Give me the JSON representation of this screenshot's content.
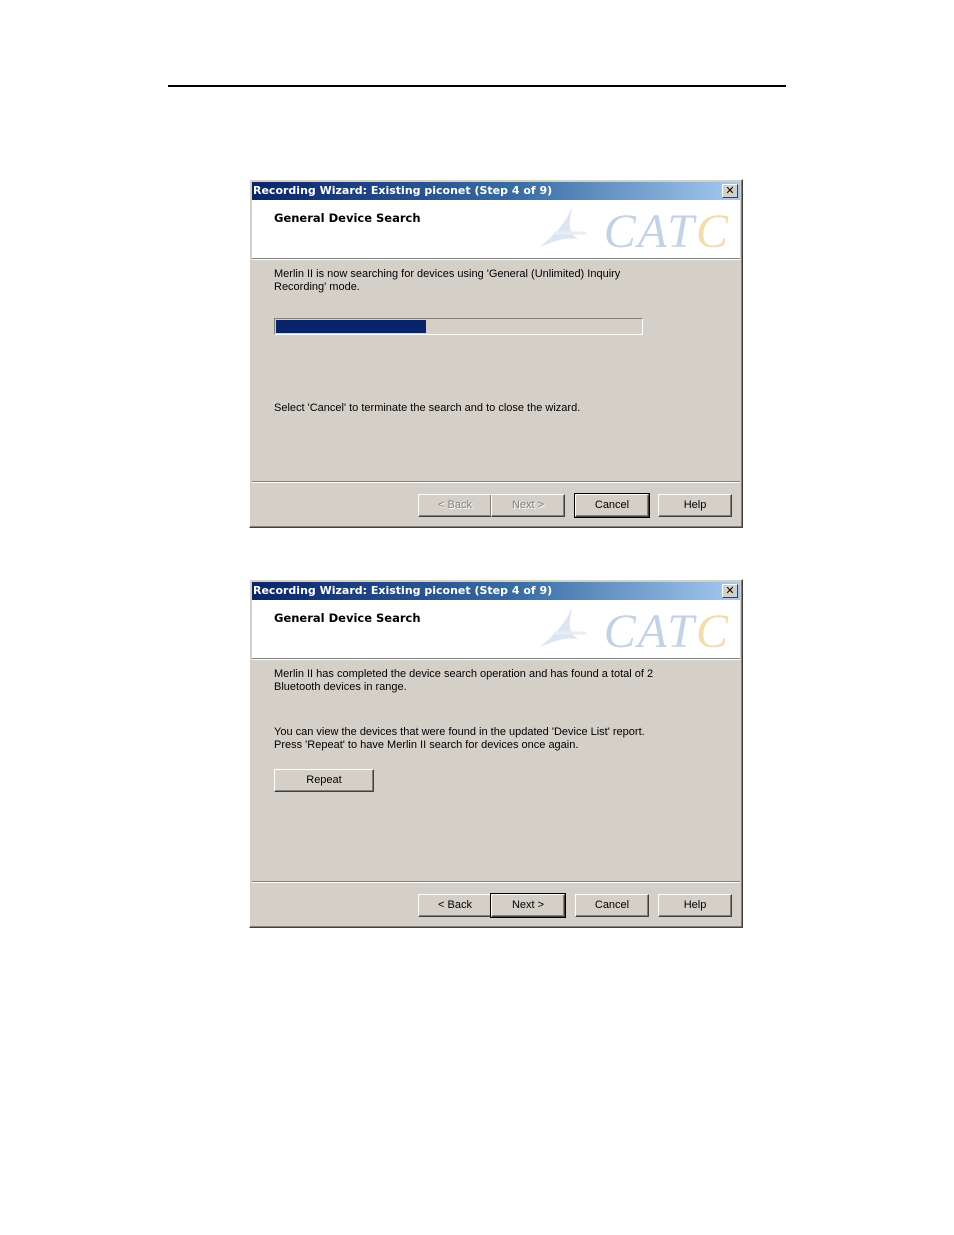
{
  "dialog1": {
    "title": "Recording Wizard: Existing piconet (Step 4 of 9)",
    "close_glyph": "✕",
    "header_title": "General Device Search",
    "logo_text": "CATC",
    "text_line1": "Merlin II is now searching for devices using 'General (Unlimited) Inquiry",
    "text_line2": "Recording' mode.",
    "progress_fraction": 0.41,
    "cancel_note": "Select 'Cancel' to terminate the search and to close the wizard.",
    "buttons": {
      "back": "< Back",
      "next": "Next >",
      "cancel": "Cancel",
      "help": "Help"
    }
  },
  "dialog2": {
    "title": "Recording Wizard: Existing piconet (Step 4 of 9)",
    "close_glyph": "✕",
    "header_title": "General Device Search",
    "logo_text": "CATC",
    "text_line1": "Merlin II has completed the device search operation and has found a total of 2",
    "text_line2": "Bluetooth devices in range.",
    "text_line3": "You can view the devices that were found in the updated 'Device List' report.",
    "text_line4": "Press 'Repeat' to have Merlin II search for devices once again.",
    "repeat_label": "Repeat",
    "buttons": {
      "back": "< Back",
      "next": "Next >",
      "cancel": "Cancel",
      "help": "Help"
    }
  },
  "colors": {
    "dialog_face": "#d4d0c8",
    "titlebar_start": "#0a246a",
    "titlebar_end": "#a6caf0",
    "progress_fill": "#0a246a"
  }
}
